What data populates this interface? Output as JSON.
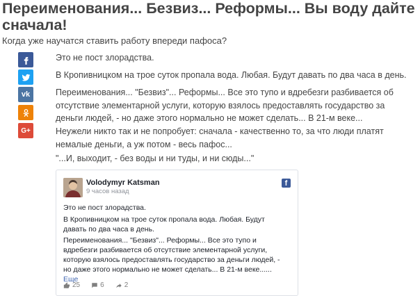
{
  "article": {
    "title": "Переименования... Безвиз... Реформы... Вы воду дайте сначала!",
    "subtitle": "Когда уже научатся ставить работу впереди пафоса?",
    "paragraphs": [
      "Это не пост злорадства.",
      "В Кропивницком на трое суток пропала вода. Любая. Будут давать по два часа в день.",
      "Переименования... \"Безвиз\"... Реформы... Все это тупо и вдребезги разбивается об отсутствие элементарной услуги, которую взялось предоставлять государство за деньги людей, - но даже этого нормально не может сделать... В 21-м веке...",
      "Неужели никто так и не попробует: сначала - качественно то, за что люди платят немалые деньги, а уж потом - весь пафос...",
      "\"...И, выходит, - без воды и ни туды, и ни сюды...\""
    ]
  },
  "share": [
    {
      "name": "facebook",
      "color": "#3b5998",
      "glyph": "f"
    },
    {
      "name": "twitter",
      "color": "#1da1f2",
      "glyph": "t"
    },
    {
      "name": "vkontakte",
      "color": "#4c75a3",
      "glyph": "vk"
    },
    {
      "name": "odnoklassniki",
      "color": "#ee8208",
      "glyph": "ok"
    },
    {
      "name": "google-plus",
      "color": "#dd4b39",
      "glyph": "G+"
    }
  ],
  "embed": {
    "author": "Volodymyr Katsman",
    "time": "9 часов назад",
    "p1": "Это не пост злорадства.",
    "p2": "В Кропивницком на трое суток пропала вода. Любая. Будут давать по два часа в день.",
    "p3": "Переименования... \"Безвиз\"... Реформы... Все это тупо и вдребезги разбивается об отсутствие элементарной услуги, которую взялось предоставлять государство за деньги людей, - но даже этого нормально не может сделать... В 21-м веке......",
    "more": "Еще",
    "likes": "25",
    "comments": "6",
    "shares": "2"
  }
}
